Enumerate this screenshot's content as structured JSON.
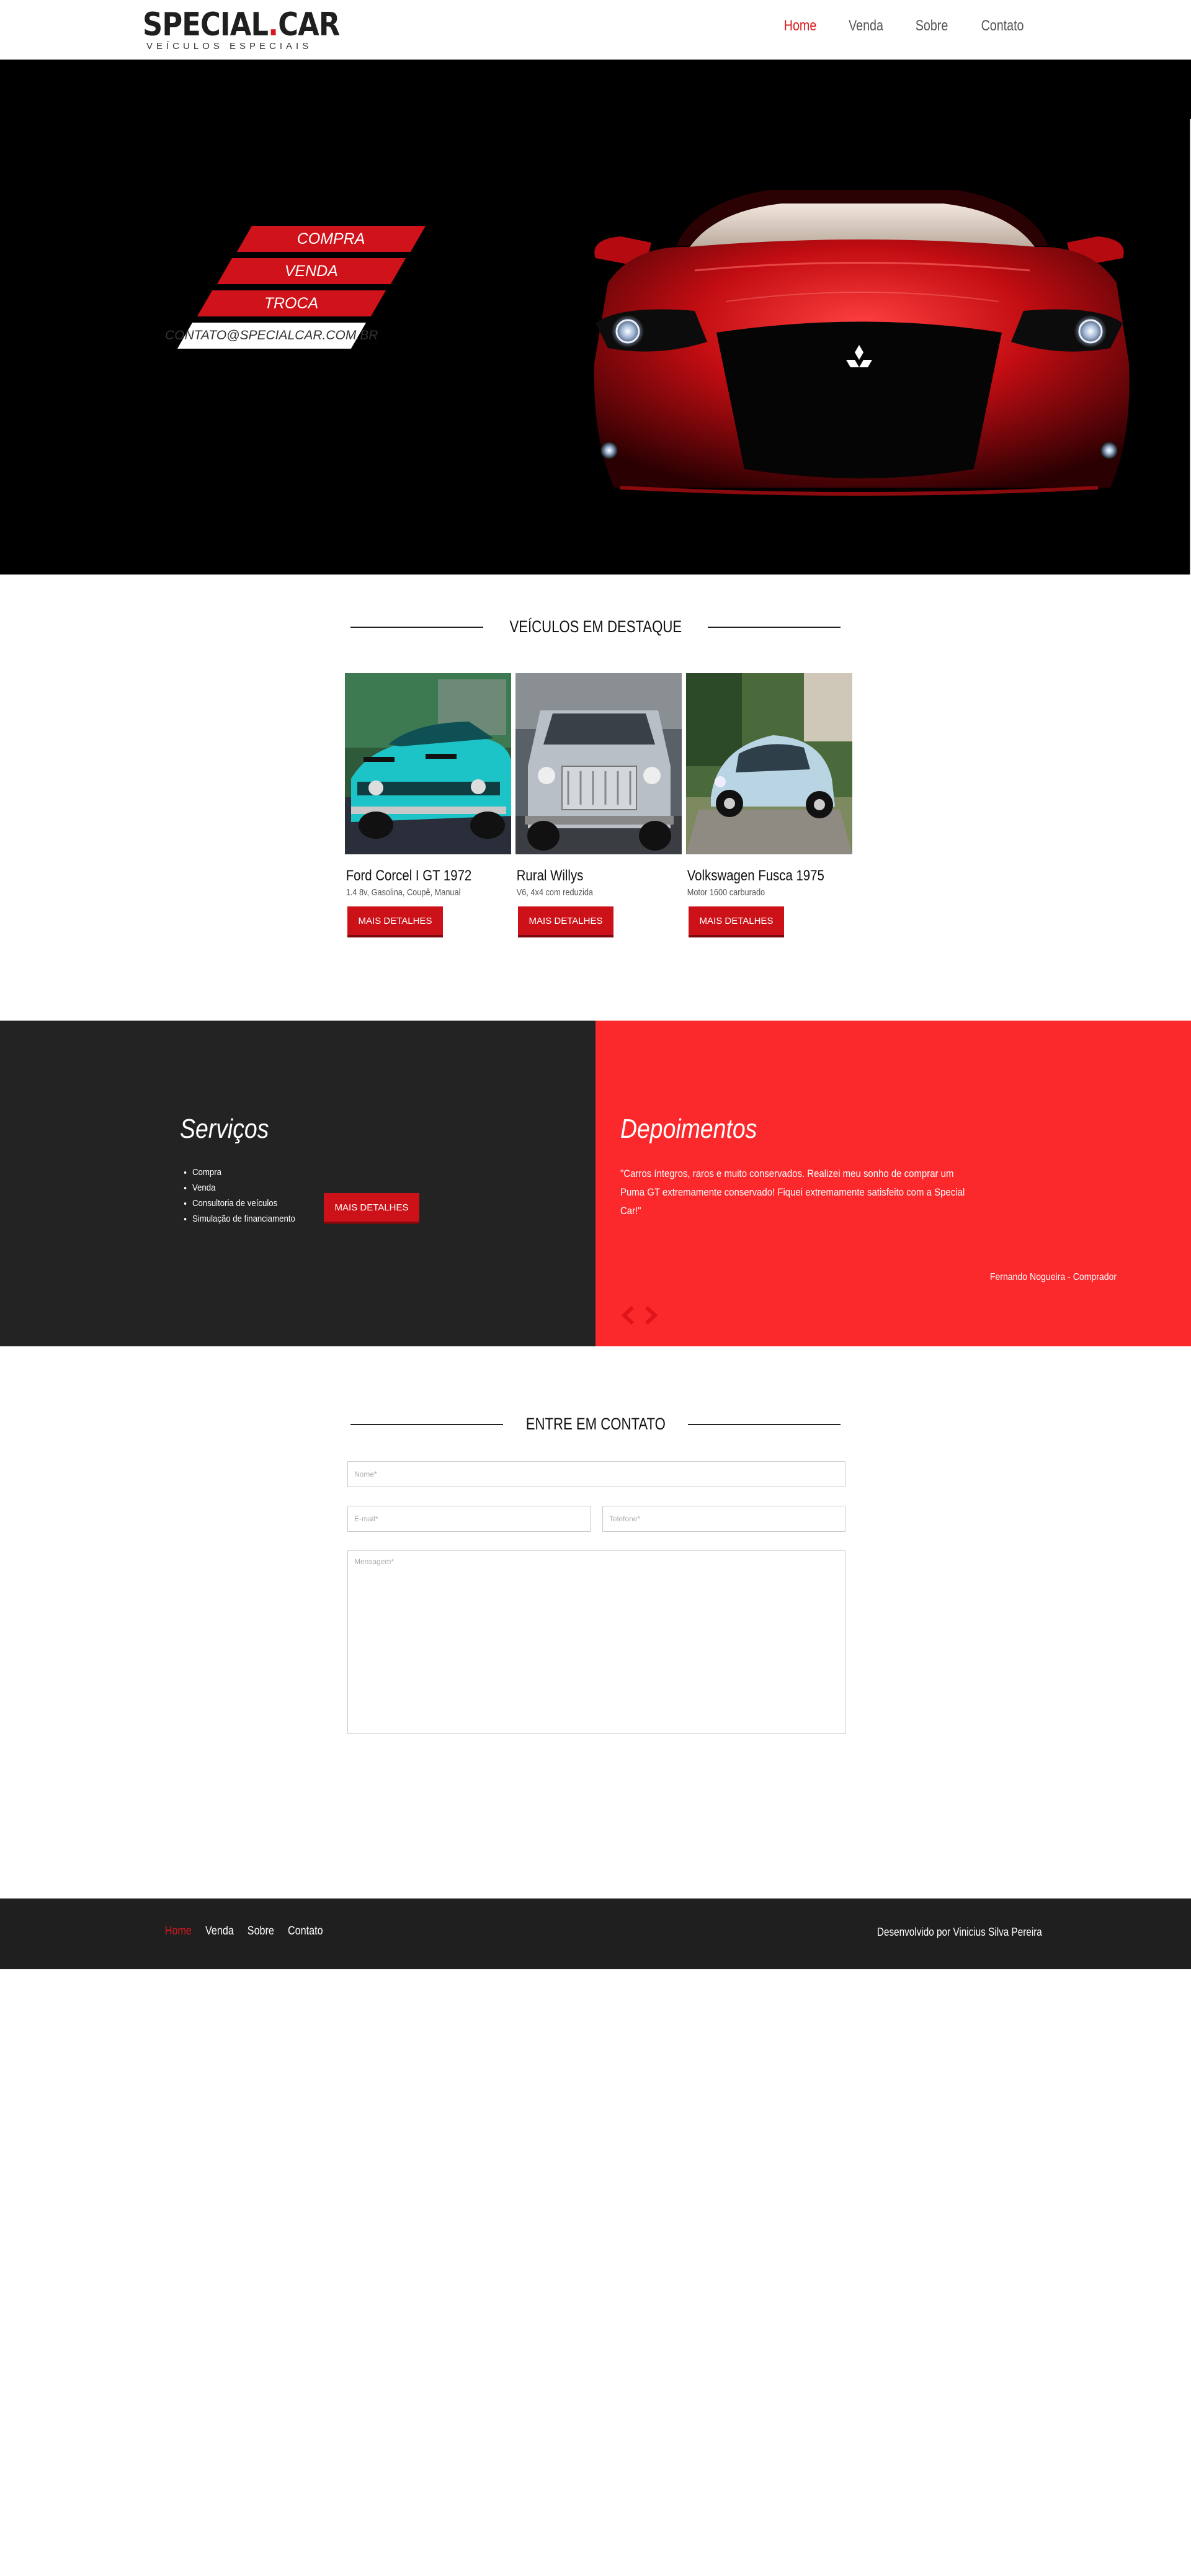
{
  "brand": {
    "name": "SPECIAL",
    "dot": ".",
    "name_suffix": "CAR",
    "tagline": "VEÍCULOS ESPECIAIS"
  },
  "nav": {
    "items": [
      {
        "label": "Home",
        "active": true
      },
      {
        "label": "Venda",
        "active": false
      },
      {
        "label": "Sobre",
        "active": false
      },
      {
        "label": "Contato",
        "active": false
      }
    ]
  },
  "hero": {
    "menu": [
      "COMPRA",
      "VENDA",
      "TROCA"
    ],
    "email": "CONTATO@SPECIALCAR.COM.BR"
  },
  "featured": {
    "title": "VEÍCULOS EM DESTAQUE",
    "cars": [
      {
        "name": "Ford Corcel I GT 1972",
        "desc": "1.4 8v, Gasolina, Coupê, Manual",
        "button": "MAIS DETALHES"
      },
      {
        "name": "Rural Willys",
        "desc": "V6, 4x4 com reduzida",
        "button": "MAIS DETALHES"
      },
      {
        "name": "Volkswagen Fusca 1975",
        "desc": "Motor 1600 carburado",
        "button": "MAIS DETALHES"
      }
    ]
  },
  "services": {
    "title": "Serviços",
    "items": [
      "Compra",
      "Venda",
      "Consultoria de veículos",
      "Simulação de financiamento"
    ],
    "button": "MAIS DETALHES"
  },
  "testimonials": {
    "title": "Depoimentos",
    "quote": "\"Carros íntegros, raros e muito conservados. Realizei meu sonho de comprar um Puma GT extremamente conservado! Fiquei extremamente satisfeito com a Special Car!\"",
    "author": "Fernando Nogueira - Comprador"
  },
  "contact": {
    "title": "ENTRE EM CONTATO",
    "name_placeholder": "Nome*",
    "email_placeholder": "E-mail*",
    "phone_placeholder": "Telefone*",
    "message_placeholder": "Mensagem*"
  },
  "footer": {
    "nav": [
      {
        "label": "Home",
        "active": true
      },
      {
        "label": "Venda",
        "active": false
      },
      {
        "label": "Sobre",
        "active": false
      },
      {
        "label": "Contato",
        "active": false
      }
    ],
    "credit": "Desenvolvido por Vinicius Silva Pereira"
  },
  "colors": {
    "accent": "#d8181e",
    "button": "#cd1118",
    "dark": "#232323",
    "testimonial_bg": "#fb282c",
    "hero_bg": "#000000"
  },
  "icons": [
    "chevron-left-icon",
    "chevron-right-icon",
    "mitsubishi-logo-icon"
  ]
}
